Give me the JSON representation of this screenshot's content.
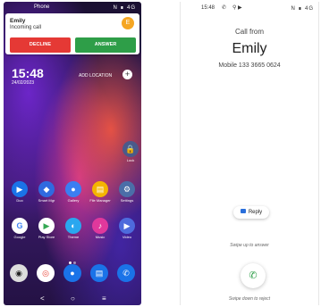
{
  "left": {
    "status": {
      "app": "Phone",
      "icons": "N ∎ 4G"
    },
    "notification": {
      "name": "Emily",
      "subtitle": "Incoming call",
      "avatar_letter": "E",
      "decline": "DECLINE",
      "answer": "ANSWER"
    },
    "clock": "15:48",
    "date": "24/02/2023",
    "add_location": "ADD LOCATION",
    "apps_row1": [
      {
        "name": "Lock",
        "color": "#4a5a8a",
        "glyph": "🔒"
      }
    ],
    "apps_row2": [
      {
        "name": "Duo",
        "color": "#1a73e8",
        "glyph": "▶"
      },
      {
        "name": "Smart Mgr",
        "color": "#2f6ae0",
        "glyph": "◆"
      },
      {
        "name": "Gallery",
        "color": "#3b7ef2",
        "glyph": "●"
      },
      {
        "name": "File Manager",
        "color": "#f4b400",
        "glyph": "▤"
      },
      {
        "name": "Settings",
        "color": "#4b6ea8",
        "glyph": "⚙"
      }
    ],
    "apps_row3": [
      {
        "name": "Google",
        "color": "#ffffff",
        "glyph": "G"
      },
      {
        "name": "Play Store",
        "color": "#ffffff",
        "glyph": "▶"
      },
      {
        "name": "Theme",
        "color": "#2aa7ef",
        "glyph": "◐"
      },
      {
        "name": "Music",
        "color": "#e0389c",
        "glyph": "♪"
      },
      {
        "name": "Video",
        "color": "#4e6bdc",
        "glyph": "▶"
      }
    ],
    "dock": [
      {
        "name": "Camera",
        "color": "#222222",
        "glyph": "◉"
      },
      {
        "name": "Chrome",
        "color": "#ffffff",
        "glyph": "◎"
      },
      {
        "name": "Contacts",
        "color": "#1a73e8",
        "glyph": "●"
      },
      {
        "name": "Messages",
        "color": "#1a73e8",
        "glyph": "▤"
      },
      {
        "name": "Phone",
        "color": "#1a73e8",
        "glyph": "✆"
      }
    ],
    "nav": {
      "back": "<",
      "home": "○",
      "menu": "≡"
    }
  },
  "right": {
    "status": {
      "time": "15:48",
      "icon1": "✆",
      "icon2": "⚲ ▶",
      "right": "N ∎ 4G"
    },
    "call_from": "Call from",
    "caller": "Emily",
    "number": "Mobile 133 3665 0624",
    "reply": "Reply",
    "swipe_up": "Swipe up to answer",
    "swipe_down": "Swipe down to reject",
    "answer_glyph": "✆"
  }
}
